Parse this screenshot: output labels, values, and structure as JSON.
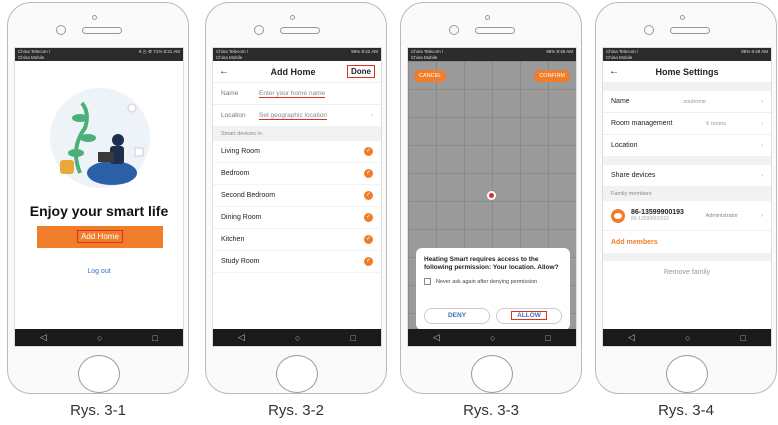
{
  "colors": {
    "accent": "#f07d2a",
    "highlight": "#e0311f",
    "link": "#3a6fc4"
  },
  "statusbar": {
    "s1_carrier": "China Telecom / China Mobile",
    "s1_right": "8 ◷ ⚙ 71% 8:31 AM",
    "s2_carrier": "China Telecom / China Mobile",
    "s2_right": "96% 8:42 AM",
    "s3_carrier": "China Telecom / China Mobile",
    "s3_right": "96% 8:46 AM",
    "s4_carrier": "China Telecom / China Mobile",
    "s4_right": "95% 8:49 AM"
  },
  "navbar": {
    "back": "◁",
    "home": "○",
    "recent": "□"
  },
  "captions": [
    "Rys. 3-1",
    "Rys. 3-2",
    "Rys. 3-3",
    "Rys. 3-4"
  ],
  "screen1": {
    "title": "Enjoy your smart life",
    "add_home": "Add Home",
    "logout": "Log out"
  },
  "screen2": {
    "back": "←",
    "title": "Add Home",
    "done": "Done",
    "name_label": "Name",
    "name_placeholder": "Enter your home name",
    "location_label": "Location",
    "location_value": "Set geographic location",
    "section": "Smart devices in:",
    "rooms": [
      "Living Room",
      "Bedroom",
      "Second Bedroom",
      "Dining Room",
      "Kitchen",
      "Study Room"
    ]
  },
  "screen3": {
    "cancel": "CANCEL",
    "confirm": "CONFIRM",
    "message": "Heating Smart requires access to the following permission: Your location. Allow?",
    "never_ask": "Never ask again after denying permission",
    "deny": "DENY",
    "allow": "ALLOW"
  },
  "screen4": {
    "back": "←",
    "title": "Home Settings",
    "name_label": "Name",
    "name_value": "zouhome",
    "rooms_label": "Room management",
    "rooms_value": "6 rooms",
    "location_label": "Location",
    "share_label": "Share devices",
    "family_section": "Family members",
    "member_number": "86-13599900193",
    "member_sub": "86-13599900193",
    "member_role": "Administrator",
    "add_members": "Add members",
    "remove_family": "Remove family"
  }
}
